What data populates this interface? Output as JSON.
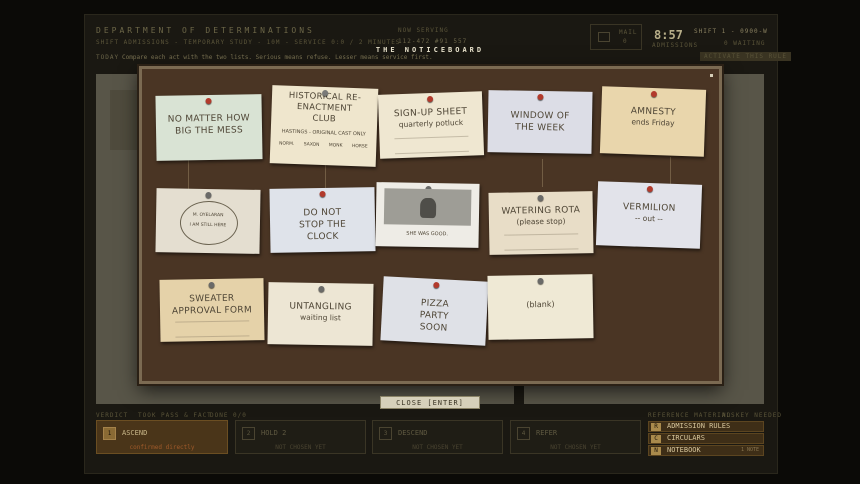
{
  "header": {
    "department": "DEPARTMENT OF DETERMINATIONS",
    "subtitle": "SHIFT ADMISSIONS  -  TEMPORARY STUDY  -  10M  -  SERVICE 0:0 / 2 MINUTES",
    "now_serving_label": "NOW SERVING",
    "now_serving_value": "112-472 #91 557",
    "instruction_tag": "TODAY",
    "instruction": "Compare each act with the two lists. Serious means refuse. Lesser means service first.",
    "rule_chip": "ACTIVATE THIS RULE",
    "mail_label": "MAIL",
    "mail_count": "0",
    "clock": "8:57",
    "clock_label": "ADMISSIONS",
    "shift": "SHIFT 1  -  0900-W",
    "waiting": "0 WAITING"
  },
  "board": {
    "title": "THE NOTICEBOARD",
    "close_label": "CLOSE  [ENTER]"
  },
  "notes": {
    "n1": "NO MATTER HOW BIG THE MESS",
    "n2_title": "HISTORICAL RE-ENACTMENT CLUB",
    "n2_line": "HASTINGS - ORIGINAL CAST ONLY",
    "n2_tags": [
      "NORM.",
      "SAXON",
      "MONK",
      "HORSE"
    ],
    "n3_title": "SIGN-UP SHEET",
    "n3_sub": "quarterly potluck",
    "n4": "WINDOW OF THE WEEK",
    "n5_title": "AMNESTY",
    "n5_sub": "ends Friday",
    "n6_name": "M. OYELARAN",
    "n6_text": "I AM STILL HERE",
    "n7": "DO NOT STOP THE CLOCK",
    "n8_caption": "SHE WAS GOOD.",
    "n9_title": "WATERING ROTA",
    "n9_sub": "(please stop)",
    "n10_title": "VERMILION",
    "n10_sub": "-- out --",
    "n11": "SWEATER APPROVAL FORM",
    "n12_title": "UNTANGLING",
    "n12_sub": "waiting list",
    "n13": "PIZZA PARTY SOON",
    "n14": "(blank)"
  },
  "actions": [
    {
      "key": "1",
      "label": "ASCEND",
      "sub": "confirmed directly"
    },
    {
      "key": "2",
      "label": "HOLD 2",
      "sub": "NOT CHOSEN YET"
    },
    {
      "key": "3",
      "label": "DESCEND",
      "sub": "NOT CHOSEN YET"
    },
    {
      "key": "4",
      "label": "REFER",
      "sub": "NOT CHOSEN YET"
    }
  ],
  "side_buttons": [
    {
      "key": "R",
      "label": "ADMISSION RULES"
    },
    {
      "key": "C",
      "label": "CIRCULARS"
    },
    {
      "key": "N",
      "label": "NOTEBOOK",
      "hint": "1 NOTE"
    }
  ],
  "footer": {
    "left": "VERDICT",
    "mid1": "TOOK PASS & FACT",
    "mid2": "DONE 0/0",
    "right": "REFERENCE MATERIALS",
    "right2": "NO KEY NEEDED"
  },
  "colors": {
    "board": "#4a3524",
    "frame": "#7b6a52",
    "pin_red": "#b23a2c",
    "pin_gray": "#6a6a68",
    "active": "#4a3519"
  }
}
